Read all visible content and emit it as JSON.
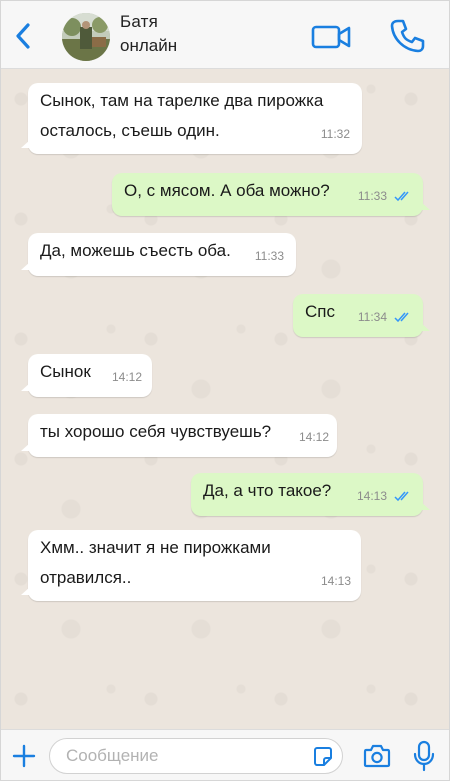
{
  "header": {
    "contact_name": "Батя",
    "contact_status": "онлайн"
  },
  "colors": {
    "accent": "#1a7fe0",
    "incoming_bubble": "#ffffff",
    "outgoing_bubble": "#dcf8c6",
    "chat_background": "#ece5dd",
    "read_ticks": "#3497f9"
  },
  "icons": {
    "back": "chevron-left-icon",
    "video": "video-camera-icon",
    "call": "phone-icon",
    "attach": "plus-icon",
    "sticker": "sticker-icon",
    "camera": "camera-icon",
    "mic": "microphone-icon",
    "read": "double-check-icon"
  },
  "messages": [
    {
      "direction": "in",
      "lines": [
        "Сынок, там на тарелке два пирожка",
        "осталось, съешь один."
      ],
      "time": "11:32"
    },
    {
      "direction": "out",
      "lines": [
        "О, с мясом. А оба можно?"
      ],
      "time": "11:33",
      "read": true
    },
    {
      "direction": "in",
      "lines": [
        "Да, можешь съесть оба."
      ],
      "time": "11:33"
    },
    {
      "direction": "out",
      "lines": [
        "Спс"
      ],
      "time": "11:34",
      "read": true
    },
    {
      "direction": "in",
      "lines": [
        "Сынок"
      ],
      "time": "14:12"
    },
    {
      "direction": "in",
      "lines": [
        "ты хорошо себя чувствуешь?"
      ],
      "time": "14:12"
    },
    {
      "direction": "out",
      "lines": [
        "Да, а что такое?"
      ],
      "time": "14:13",
      "read": true
    },
    {
      "direction": "in",
      "lines": [
        "Хмм.. значит я не пирожками",
        "отравился.."
      ],
      "time": "14:13"
    }
  ],
  "composer": {
    "placeholder": "Сообщение",
    "value": ""
  }
}
